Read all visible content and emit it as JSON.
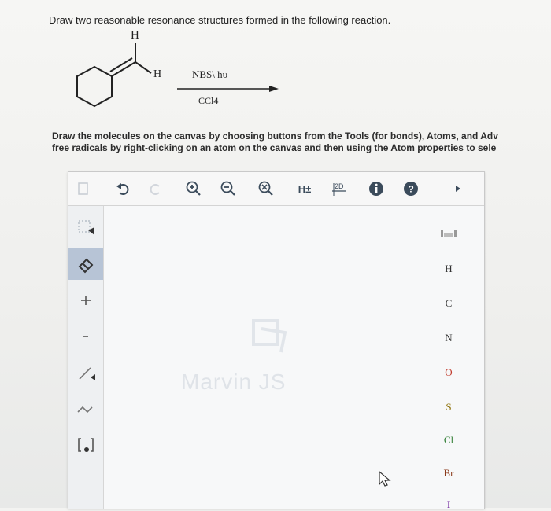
{
  "question": "Draw two reasonable resonance structures formed in the following reaction.",
  "reaction": {
    "top_h": "H",
    "side_h": "H",
    "reagent_above": "NBS\\ hυ",
    "reagent_below": "CCl4"
  },
  "instructions": {
    "line1": "Draw the molecules on the canvas by choosing buttons from the Tools (for bonds), Atoms, and Adv",
    "line2": "free radicals by right-clicking on an atom on the canvas and then using the Atom properties to sele"
  },
  "toolbar": {
    "hydrogens_label": "H±",
    "view_label": "2D",
    "icons": [
      "new-document-icon",
      "undo-icon",
      "redo-icon",
      "zoom-in-icon",
      "zoom-out-icon",
      "zoom-reset-icon",
      "hydrogens-toggle-icon",
      "2d-clean-icon",
      "info-icon",
      "help-icon",
      "more-arrow-icon"
    ]
  },
  "atoms": {
    "periodic_label": "periodic table",
    "items": [
      "H",
      "C",
      "N",
      "O",
      "S",
      "Cl",
      "Br",
      "I"
    ]
  },
  "watermark": "Marvin JS"
}
